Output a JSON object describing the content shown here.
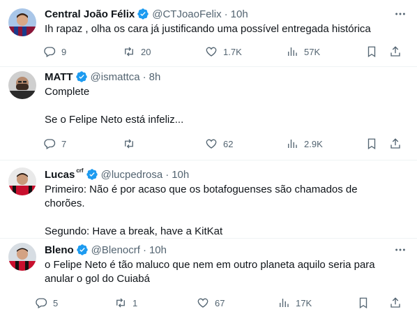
{
  "tweets": [
    {
      "name": "Central João Félix",
      "handle": "@CTJoaoFelix",
      "time": "10h",
      "text": "Ih rapaz , olha os cara já justificando uma possível entregada histórica",
      "replies": "9",
      "retweets": "20",
      "likes": "1.7K",
      "views": "57K"
    },
    {
      "name": "MATT",
      "handle": "@ismattca",
      "time": "8h",
      "text": "Complete\n\nSe o Felipe Neto está infeliz...",
      "replies": "7",
      "retweets": "",
      "likes": "62",
      "views": "2.9K"
    },
    {
      "name": "Lucas",
      "name_badge": "crf",
      "handle": "@lucpedrosa",
      "time": "10h",
      "text": "Primeiro: Não é por acaso que os botafoguenses são chamados de\nchorões.\n\nSegundo: Have a break, have a KitKat"
    },
    {
      "name": "Bleno",
      "handle": "@Blenocrf",
      "time": "10h",
      "text": "o Felipe Neto é tão maluco que nem em outro planeta aquilo seria para\nanular o gol do Cuiabá",
      "replies": "5",
      "retweets": "1",
      "likes": "67",
      "views": "17K"
    }
  ],
  "separator": "·",
  "icons": {
    "verified": "verified-badge-icon",
    "more": "more-dots-icon",
    "reply": "reply-icon",
    "retweet": "retweet-icon",
    "like": "heart-icon",
    "views": "views-bar-icon",
    "bookmark": "bookmark-icon",
    "share": "share-icon"
  },
  "colors": {
    "verified": "#1d9bf0",
    "muted": "#536471",
    "text": "#0f1419",
    "divider": "#eff3f4"
  }
}
